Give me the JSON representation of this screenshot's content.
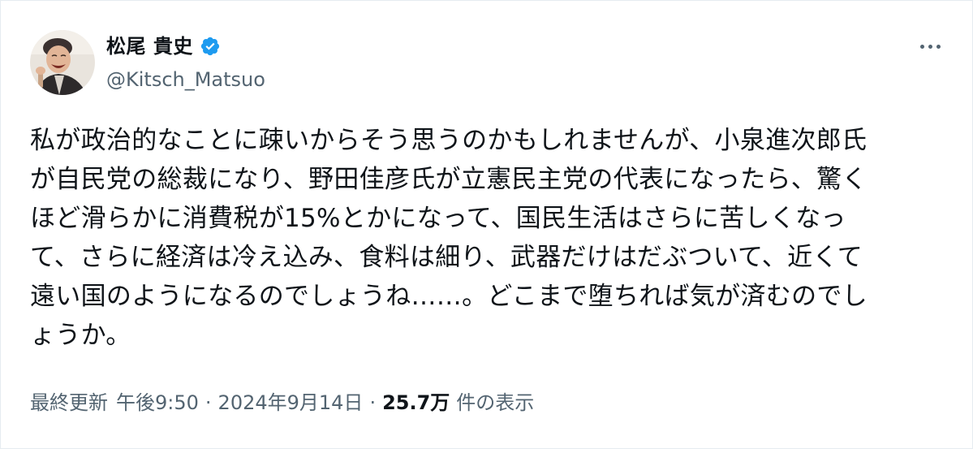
{
  "author": {
    "display_name": "松尾 貴史",
    "handle": "@Kitsch_Matsuo",
    "verified": true
  },
  "tweet": {
    "lines": [
      "私が政治的なことに疎いからそう思うのかもしれませんが、小泉進次郎氏",
      "が自民党の総裁になり、野田佳彦氏が立憲民主党の代表になったら、驚く",
      "ほど滑らかに消費税が15%とかになって、国民生活はさらに苦しくなっ",
      "て、さらに経済は冷え込み、食料は細り、武器だけはだぶついて、近くて",
      "遠い国のようになるのでしょうね……。どこまで堕ちれば気が済むのでし",
      "ょうか。"
    ]
  },
  "meta": {
    "updated_label": "最終更新",
    "time": "午後9:50",
    "separator": "·",
    "date": "2024年9月14日",
    "views_count": "25.7万",
    "views_label": "件の表示"
  },
  "colors": {
    "text_primary": "#0f1419",
    "text_secondary": "#536471",
    "verified_blue": "#1d9bf0",
    "border": "#e6ecf0"
  },
  "icons": {
    "verified": "verified-badge-icon",
    "more": "more-options-icon"
  }
}
